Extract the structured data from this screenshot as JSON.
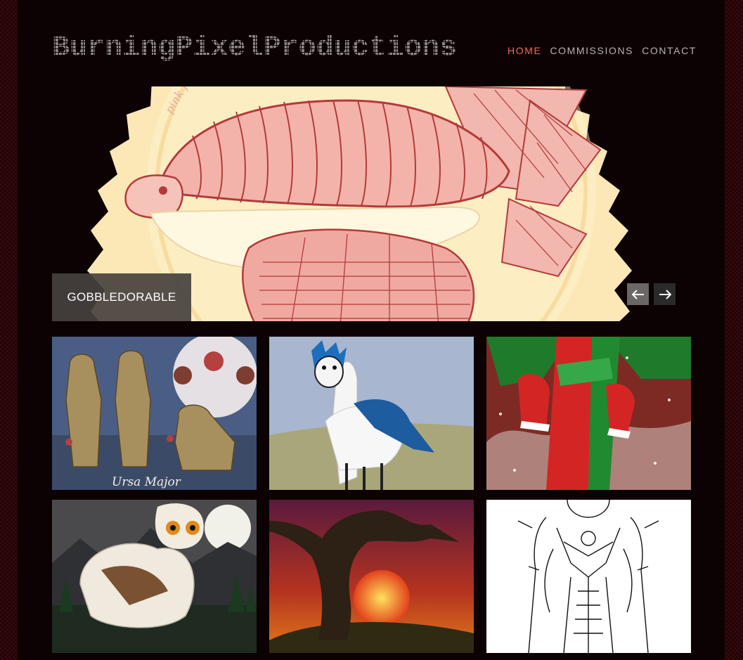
{
  "site": {
    "logo_text": "BurningPixelProductions"
  },
  "nav": {
    "items": [
      {
        "label": "HOME",
        "active": true
      },
      {
        "label": "COMMISSIONS",
        "active": false
      },
      {
        "label": "CONTACT",
        "active": false
      }
    ]
  },
  "slider": {
    "caption": "GOBBLEDORABLE",
    "watermark": "pink fu",
    "prev_icon": "arrow-left-icon",
    "next_icon": "arrow-right-icon"
  },
  "gallery": {
    "items": [
      {
        "name": "ursa-major-thumbnail",
        "signature": "Ursa Major"
      },
      {
        "name": "blue-jay-llama-thumbnail"
      },
      {
        "name": "christmas-dragon-thumbnail"
      },
      {
        "name": "owl-dog-thumbnail"
      },
      {
        "name": "sunset-tree-thumbnail"
      },
      {
        "name": "armored-knight-lineart-thumbnail"
      }
    ]
  },
  "colors": {
    "accent": "#ef6a52",
    "nav_text": "#b9b3b2",
    "caption_bg": "#46413f",
    "background": "#0c0203"
  }
}
